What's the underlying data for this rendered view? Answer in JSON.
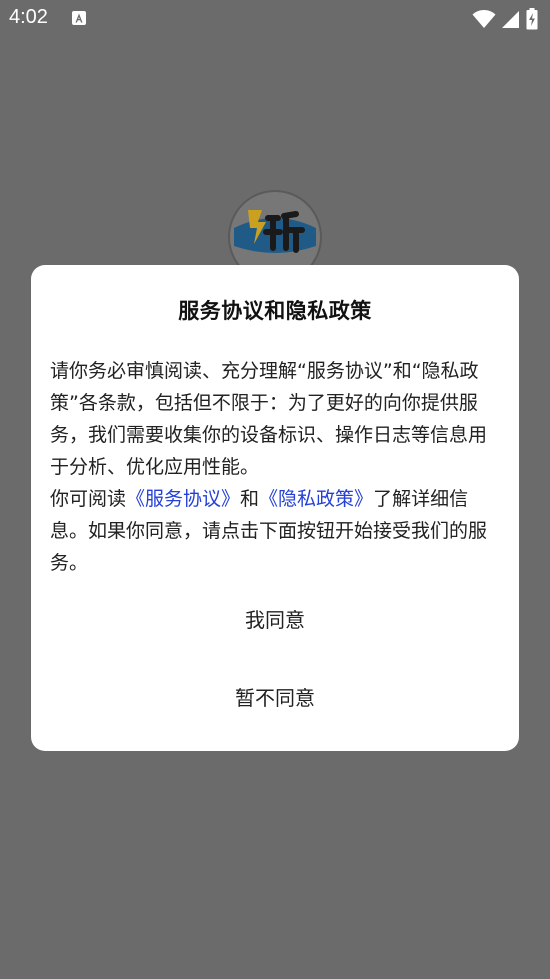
{
  "status_bar": {
    "time": "4:02",
    "notification_icon": "text-a-icon",
    "wifi_icon": "wifi-icon",
    "signal_icon": "signal-icon",
    "battery_icon": "battery-charging-icon"
  },
  "splash": {
    "logo_icon": "app-logo-icon"
  },
  "dialog": {
    "title": "服务协议和隐私政策",
    "paragraph1": "请你务必审慎阅读、充分理解“服务协议”和“隐私政策”各条款，包括但不限于：为了更好的向你提供服务，我们需要收集你的设备标识、操作日志等信息用于分析、优化应用性能。",
    "p2_prefix": "你可阅读",
    "service_link": "《服务协议》",
    "p2_and": "和",
    "privacy_link": "《隐私政策》",
    "p2_suffix": "了解详细信息。如果你同意，请点击下面按钮开始接受我们的服务。",
    "agree_label": "我同意",
    "disagree_label": "暂不同意"
  },
  "colors": {
    "overlay": "#6b6b6b",
    "link": "#2440d6",
    "dialog_bg": "#ffffff"
  }
}
